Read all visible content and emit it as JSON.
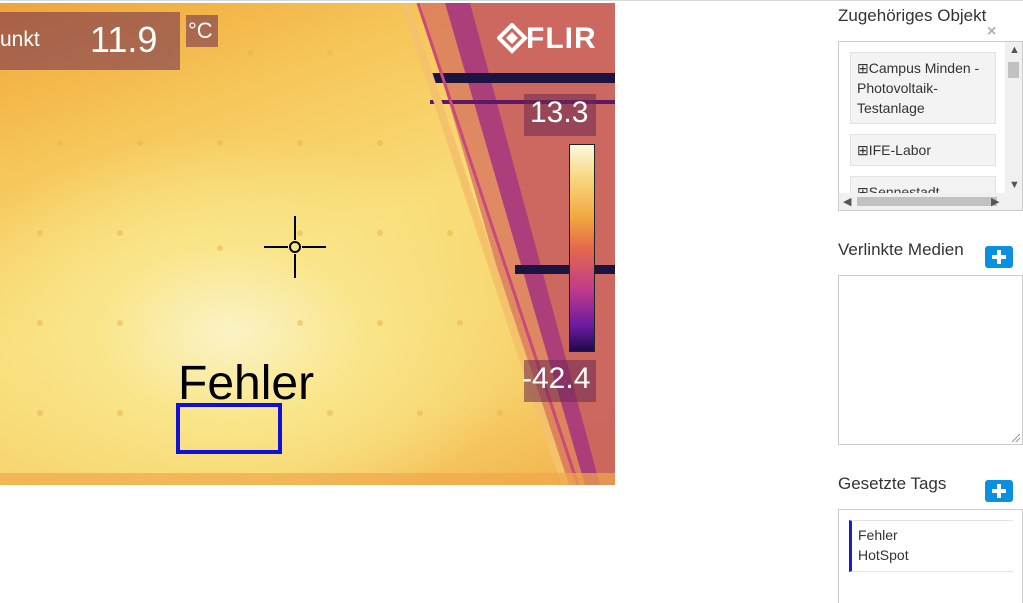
{
  "thermal": {
    "spot_label": "unkt",
    "spot_value": "11.9",
    "unit": "°C",
    "logo_text": "FLIR",
    "scale_max": "13.3",
    "scale_min": "-42.4",
    "annotation_label": "Fehler"
  },
  "sidebar": {
    "related_object": {
      "title": "Zugehöriges Objekt",
      "close_icon": "×",
      "items": [
        {
          "label": "⊞Campus Minden - Photovoltaik-Testanlage"
        },
        {
          "label": "⊞IFE-Labor"
        },
        {
          "label": "⊞Sennestadt"
        }
      ]
    },
    "linked_media": {
      "title": "Verlinkte Medien",
      "add_icon": "plus-icon"
    },
    "tags": {
      "title": "Gesetzte Tags",
      "add_icon": "plus-icon",
      "values": [
        "Fehler",
        "HotSpot"
      ]
    }
  },
  "colors": {
    "accent_blue": "#0b8fe0",
    "annotation_box": "#1010d8",
    "tag_marker": "#1b1bd0"
  }
}
